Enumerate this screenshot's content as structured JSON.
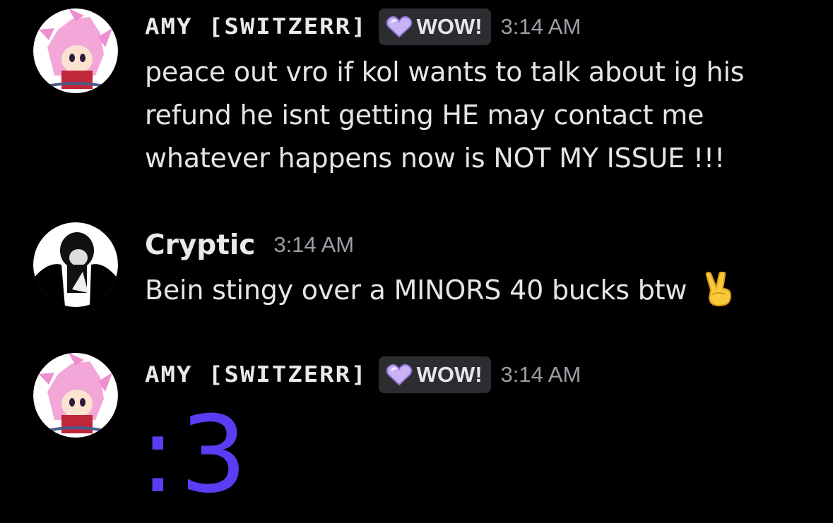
{
  "messages": [
    {
      "author": "AMY [SWITZERR]",
      "tag_label": "WOW!",
      "timestamp": "3:14 AM",
      "lines": [
        "peace out vro if kol wants to talk about ig his",
        "refund he isnt getting HE may contact me",
        "whatever happens now is NOT MY ISSUE !!!"
      ]
    },
    {
      "author": "Cryptic",
      "timestamp": "3:14 AM",
      "text": "Bein stingy over a MINORS 40 bucks btw",
      "emoji": "victory-hand-emoji"
    },
    {
      "author": "AMY [SWITZERR]",
      "tag_label": "WOW!",
      "timestamp": "3:14 AM",
      "emote_text": ":3"
    }
  ],
  "colors": {
    "background": "#000000",
    "tag_background": "#2b2d31",
    "timestamp": "#9c9ea6",
    "big_emote": "#5b3cf2",
    "heart_badge": "#c9b2f5"
  }
}
